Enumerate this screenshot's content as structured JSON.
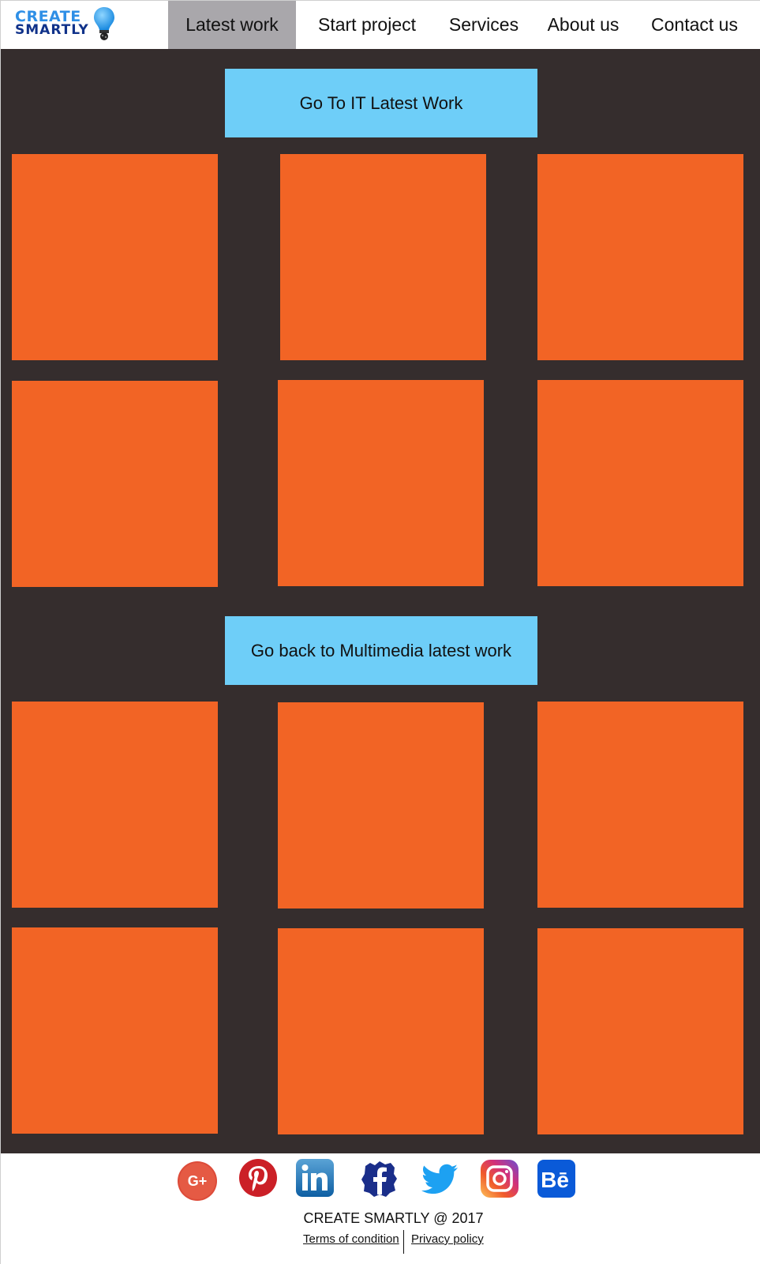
{
  "brand": {
    "name_line1": "CREATE",
    "name_line2": "SMARTLY",
    "logo_icon": "lightbulb-icon"
  },
  "nav": {
    "items": [
      {
        "label": "Latest work",
        "active": true
      },
      {
        "label": "Start project",
        "active": false
      },
      {
        "label": "Services",
        "active": false
      },
      {
        "label": "About us",
        "active": false
      },
      {
        "label": "Contact us",
        "active": false
      }
    ],
    "active_color": "#a9a7ab"
  },
  "main": {
    "background": "#352d2d",
    "cta_it_label": "Go To IT Latest Work",
    "cta_mm_label": "Go back to Multimedia latest work",
    "cta_color": "#6ecef8",
    "tile_color": "#f26425",
    "section1_tile_count": 6,
    "section2_tile_count": 6
  },
  "footer": {
    "social_icons": [
      "google-plus-icon",
      "pinterest-icon",
      "linkedin-icon",
      "facebook-icon",
      "twitter-icon",
      "instagram-icon",
      "behance-icon"
    ],
    "copyright": "CREATE SMARTLY @ 2017",
    "terms_label": "Terms of condition",
    "privacy_label": "Privacy policy"
  }
}
